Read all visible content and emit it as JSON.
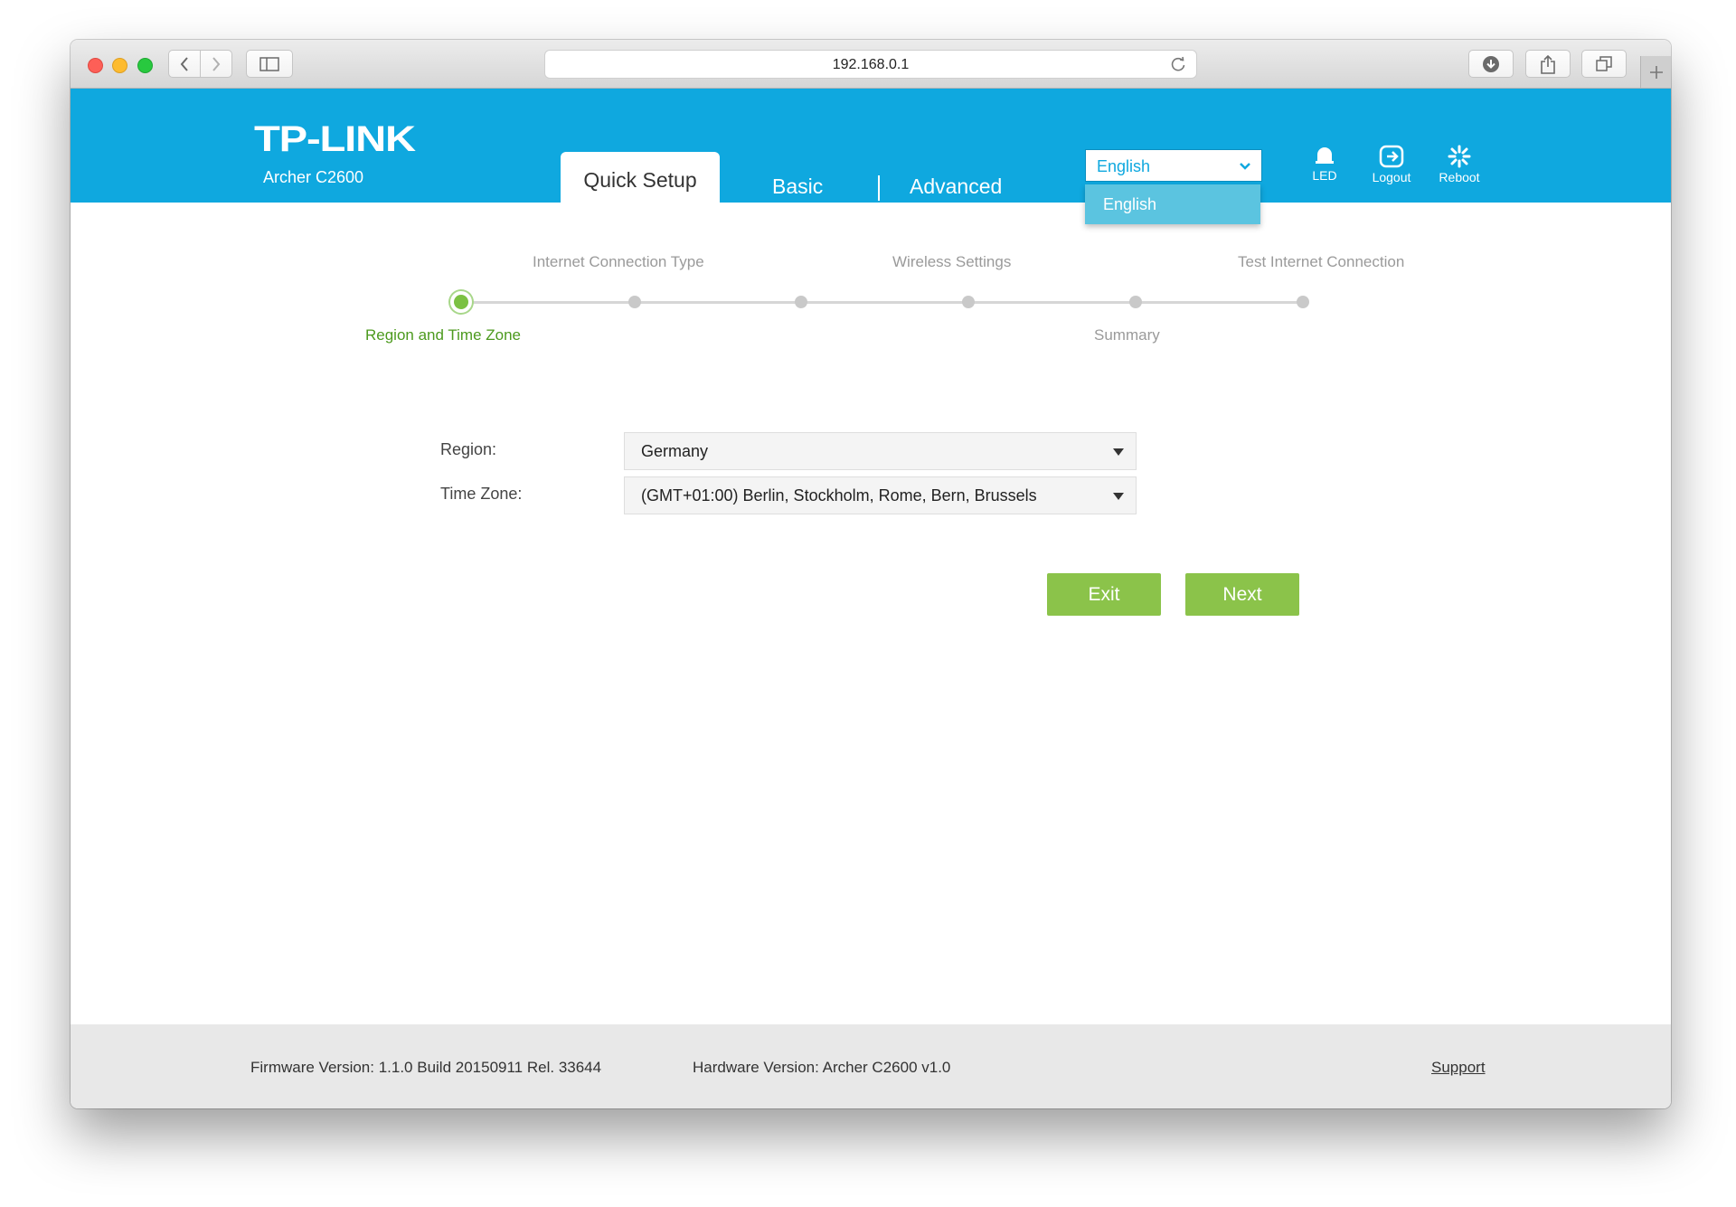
{
  "browser": {
    "url": "192.168.0.1"
  },
  "header": {
    "logo": "TP-LINK",
    "model": "Archer C2600",
    "tabs": [
      {
        "label": "Quick Setup",
        "active": true
      },
      {
        "label": "Basic",
        "active": false
      },
      {
        "label": "Advanced",
        "active": false
      }
    ],
    "language": {
      "selected": "English",
      "options": [
        "English"
      ]
    },
    "tools": [
      {
        "label": "LED",
        "icon": "bell-icon"
      },
      {
        "label": "Logout",
        "icon": "logout-icon"
      },
      {
        "label": "Reboot",
        "icon": "reboot-icon"
      }
    ],
    "accent_color": "#0fa8df"
  },
  "wizard": {
    "steps": [
      {
        "label": "Region and Time Zone",
        "current": true
      },
      {
        "label": "Internet Connection Type",
        "current": false
      },
      {
        "label": "",
        "current": false
      },
      {
        "label": "Wireless Settings",
        "current": false
      },
      {
        "label": "Summary",
        "current": false
      },
      {
        "label": "Test Internet Connection",
        "current": false
      }
    ],
    "current_color": "#7bc142"
  },
  "form": {
    "region_label": "Region:",
    "region_value": "Germany",
    "timezone_label": "Time Zone:",
    "timezone_value": "(GMT+01:00) Berlin, Stockholm, Rome, Bern, Brussels"
  },
  "buttons": {
    "exit": "Exit",
    "next": "Next",
    "color": "#8bc34a"
  },
  "footer": {
    "firmware": "Firmware Version: 1.1.0 Build 20150911 Rel. 33644",
    "hardware": "Hardware Version: Archer C2600 v1.0",
    "support": "Support"
  }
}
